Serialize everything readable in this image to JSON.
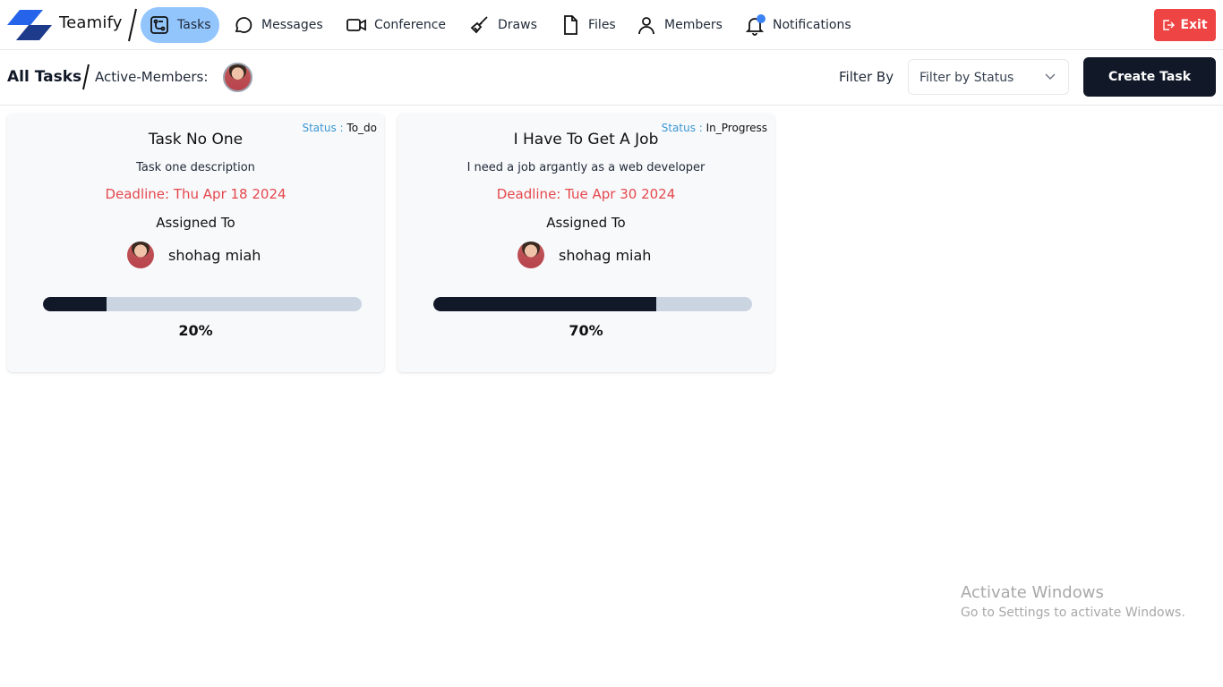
{
  "brand": {
    "name": "Teamify",
    "colors": {
      "primary": "#1e40af",
      "accent": "#3b82f6"
    }
  },
  "nav": {
    "items": [
      {
        "label": "Tasks",
        "icon": "tasks-icon",
        "active": true
      },
      {
        "label": "Messages",
        "icon": "chat-bubble-icon"
      },
      {
        "label": "Conference",
        "icon": "video-camera-icon"
      },
      {
        "label": "Draws",
        "icon": "brush-icon"
      },
      {
        "label": "Files",
        "icon": "file-icon"
      },
      {
        "label": "Members",
        "icon": "user-icon"
      },
      {
        "label": "Notifications",
        "icon": "bell-icon"
      }
    ],
    "exit_label": "Exit"
  },
  "subheader": {
    "title": "All Tasks",
    "active_members_label": "Active-Members:",
    "filter_label": "Filter By",
    "filter_placeholder": "Filter by Status",
    "create_label": "Create Task"
  },
  "tasks": [
    {
      "status_key": "Status :",
      "status": "To_do",
      "title": "Task No One",
      "description": "Task one description",
      "deadline": "Deadline: Thu Apr 18 2024",
      "assigned_label": "Assigned To",
      "assignee": "shohag miah",
      "progress": 20,
      "progress_text": "20%"
    },
    {
      "status_key": "Status :",
      "status": "In_Progress",
      "title": "I Have To Get A Job",
      "description": "I need a job argantly as a web developer",
      "deadline": "Deadline: Tue Apr 30 2024",
      "assigned_label": "Assigned To",
      "assignee": "shohag miah",
      "progress": 70,
      "progress_text": "70%"
    }
  ],
  "watermark": {
    "title": "Activate Windows",
    "subtitle": "Go to Settings to activate Windows."
  }
}
